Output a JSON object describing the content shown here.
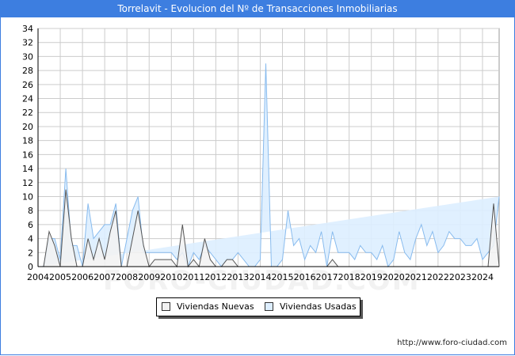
{
  "title": "Torrelavit - Evolucion del Nº de Transacciones Inmobiliarias",
  "footer_url": "http://www.foro-ciudad.com",
  "watermark": "FORO-CIUDAD.COM",
  "legend": {
    "nuevas": "Viviendas Nuevas",
    "usadas": "Viviendas Usadas"
  },
  "colors": {
    "title_bg": "#3d7ee0",
    "nuevas_fill": "#f2f2f2",
    "nuevas_line": "#555555",
    "usadas_fill": "#ddeeff",
    "usadas_line": "#88bbee",
    "grid": "#cccccc"
  },
  "chart_data": {
    "type": "area",
    "x_ticks": [
      "2004",
      "2005",
      "2006",
      "2007",
      "2008",
      "2009",
      "2010",
      "2011",
      "2012",
      "2013",
      "2014",
      "2015",
      "2016",
      "2017",
      "2018",
      "2019",
      "2020",
      "2021",
      "2022",
      "2023",
      "2024"
    ],
    "y_ticks": [
      0,
      2,
      4,
      6,
      8,
      10,
      12,
      14,
      16,
      18,
      20,
      22,
      24,
      26,
      28,
      30,
      32,
      34
    ],
    "ylim": [
      0,
      34
    ],
    "xlim": [
      2004,
      2024.75
    ],
    "x_quarters": [
      2004.25,
      2004.5,
      2004.75,
      2005,
      2005.25,
      2005.5,
      2005.75,
      2006,
      2006.25,
      2006.5,
      2006.75,
      2007,
      2007.25,
      2007.5,
      2007.75,
      2008,
      2008.25,
      2008.5,
      2008.75,
      2009,
      2009.25,
      2009.5,
      2009.75,
      2010,
      2010.25,
      2010.5,
      2010.75,
      2011,
      2011.25,
      2011.5,
      2011.75,
      2012,
      2012.25,
      2012.5,
      2012.75,
      2013,
      2013.25,
      2013.5,
      2013.75,
      2014,
      2014.25,
      2014.5,
      2014.75,
      2015,
      2015.25,
      2015.5,
      2015.75,
      2016,
      2016.25,
      2016.5,
      2016.75,
      2017,
      2017.25,
      2017.5,
      2017.75,
      2018,
      2018.25,
      2018.5,
      2018.75,
      2019,
      2019.25,
      2019.5,
      2019.75,
      2020,
      2020.25,
      2020.5,
      2020.75,
      2021,
      2021.25,
      2021.5,
      2021.75,
      2022,
      2022.25,
      2022.5,
      2022.75,
      2023,
      2023.25,
      2023.5,
      2023.75,
      2024,
      2024.25,
      2024.5,
      2024.75
    ],
    "series": [
      {
        "name": "Viviendas Nuevas",
        "values": [
          0,
          5,
          3,
          0,
          11,
          4,
          0,
          0,
          4,
          1,
          4,
          1,
          5,
          8,
          0,
          0,
          4,
          8,
          3,
          0,
          1,
          1,
          1,
          1,
          0,
          6,
          0,
          1,
          0,
          4,
          1,
          0,
          0,
          1,
          1,
          0,
          0,
          0,
          0,
          0,
          0,
          0,
          0,
          0,
          0,
          0,
          0,
          0,
          0,
          0,
          0,
          0,
          1,
          0,
          0,
          0,
          0,
          0,
          0,
          0,
          0,
          0,
          0,
          0,
          0,
          0,
          0,
          0,
          0,
          0,
          0,
          0,
          0,
          0,
          0,
          0,
          0,
          0,
          0,
          0,
          0,
          9,
          0
        ]
      },
      {
        "name": "Viviendas Usadas",
        "values": [
          0,
          4,
          4,
          1,
          14,
          3,
          3,
          0,
          9,
          4,
          5,
          6,
          6,
          9,
          0,
          4,
          8,
          10,
          2,
          2,
          2,
          2,
          2,
          2,
          1,
          2,
          0,
          2,
          1,
          3,
          2,
          1,
          0,
          1,
          1,
          2,
          1,
          0,
          0,
          1,
          29,
          0,
          0,
          1,
          8,
          3,
          4,
          1,
          3,
          2,
          5,
          0,
          5,
          2,
          2,
          2,
          1,
          3,
          2,
          2,
          1,
          3,
          0,
          1,
          5,
          2,
          1,
          4,
          6,
          3,
          5,
          2,
          3,
          5,
          4,
          4,
          3,
          3,
          4,
          1,
          2,
          3,
          10,
          3
        ]
      }
    ]
  }
}
